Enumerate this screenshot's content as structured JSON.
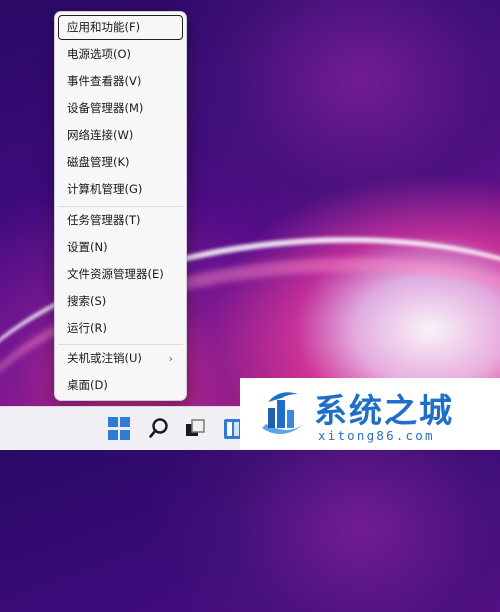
{
  "context_menu": {
    "items": [
      {
        "label": "应用和功能(F)"
      },
      {
        "label": "电源选项(O)"
      },
      {
        "label": "事件查看器(V)"
      },
      {
        "label": "设备管理器(M)"
      },
      {
        "label": "网络连接(W)"
      },
      {
        "label": "磁盘管理(K)"
      },
      {
        "label": "计算机管理(G)"
      },
      {
        "label": "任务管理器(T)"
      },
      {
        "label": "设置(N)"
      },
      {
        "label": "文件资源管理器(E)"
      },
      {
        "label": "搜索(S)"
      },
      {
        "label": "运行(R)"
      },
      {
        "label": "关机或注销(U)",
        "has_submenu": true
      },
      {
        "label": "桌面(D)"
      }
    ],
    "submenu_glyph": "›"
  },
  "taskbar": {
    "icons": [
      "windows-start-icon",
      "search-icon",
      "task-view-icon",
      "widgets-icon"
    ],
    "accent": "#2f7bd8"
  },
  "watermark": {
    "title": "系统之城",
    "url": "xitong86.com",
    "color": "#1e6fc8"
  }
}
